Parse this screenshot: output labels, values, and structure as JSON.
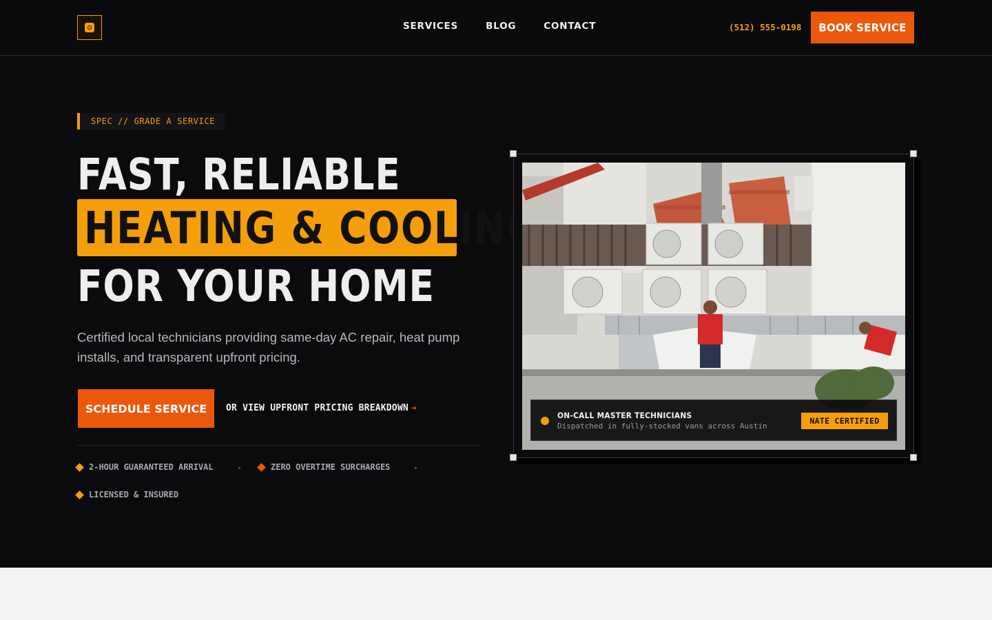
{
  "nav": {
    "logo_icon": "thermostat-logo-icon",
    "links": [
      "SERVICES",
      "BLOG",
      "CONTACT"
    ],
    "phone": "(512) 555-0198",
    "book_label": "BOOK SERVICE"
  },
  "hero": {
    "tag": "SPEC // GRADE A SERVICE",
    "headline_line1": "FAST, RELIABLE",
    "headline_line2": "HEATING & COOLING",
    "headline_line3": "FOR YOUR HOME",
    "subtitle": "Certified local technicians providing same-day AC repair, heat pump installs, and transparent upfront pricing.",
    "cta_primary": "SCHEDULE SERVICE",
    "cta_secondary": "OR VIEW UPFRONT PRICING BREAKDOWN",
    "cta_secondary_arrow": "→",
    "features": [
      {
        "label": "2-HOUR GUARANTEED ARRIVAL",
        "color": "#f59e0b"
      },
      {
        "label": "ZERO OVERTIME SURCHARGES",
        "color": "#ea580c"
      },
      {
        "label": "LICENSED & INSURED",
        "color": "#f59e0b"
      }
    ]
  },
  "photo_card": {
    "title": "ON-CALL MASTER TECHNICIANS",
    "subtitle": "Dispatched in fully-stocked vans across Austin",
    "badge": "NATE CERTIFIED"
  },
  "colors": {
    "accent_amber": "#f59e0b",
    "accent_orange": "#ea580c",
    "background": "#0b0b0d",
    "lower_section": "#f4f4f2"
  }
}
